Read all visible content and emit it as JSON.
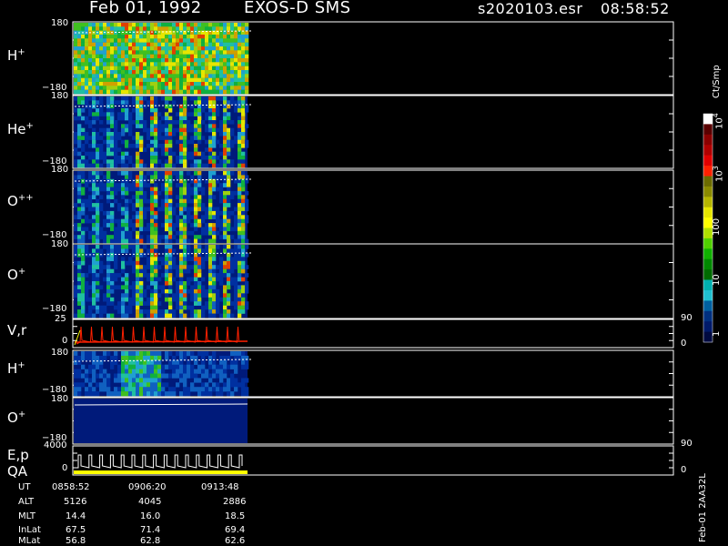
{
  "header": {
    "date": "Feb 01, 1992",
    "instrument": "EXOS-D SMS",
    "file": "s2020103.esr",
    "time": "08:58:52"
  },
  "panels": [
    {
      "label": "H",
      "charge": "+",
      "ymax": "180",
      "ymin": "−180"
    },
    {
      "label": "He",
      "charge": "+",
      "ymax": "180",
      "ymin": "−180"
    },
    {
      "label": "O",
      "charge": "++",
      "ymax": "180",
      "ymin": "−180"
    },
    {
      "label": "O",
      "charge": "+",
      "ymax": "180",
      "ymin": "−180"
    },
    {
      "label": "V,r",
      "ymax": "25",
      "ymin": "0",
      "right_max": "90",
      "right_min": "0"
    },
    {
      "label": "H",
      "charge": "+",
      "ymax": "180",
      "ymin": "−180"
    },
    {
      "label": "O",
      "charge": "+",
      "ymax": "180",
      "ymin": "−180"
    },
    {
      "label": "E,p",
      "label2": "QA",
      "ymax": "4000",
      "ymin": "0",
      "right_max": "90",
      "right_min": "0"
    }
  ],
  "colorbar": {
    "unit": "Ct/Smp",
    "labels": [
      "10",
      "4",
      "10",
      "3",
      "100",
      "10",
      "1"
    ],
    "colors": [
      "#ffffff",
      "#5a0000",
      "#8b0000",
      "#b00000",
      "#e00000",
      "#ff2000",
      "#6b6b00",
      "#8a8a00",
      "#b5b500",
      "#e6e600",
      "#ffff00",
      "#b0e000",
      "#50d000",
      "#10b000",
      "#008800",
      "#006a00",
      "#00b0b0",
      "#20c0d0",
      "#0060a0",
      "#003080",
      "#001a6a",
      "#000a40"
    ]
  },
  "footer": {
    "columns": [
      "0858:52",
      "0906:20",
      "0913:48"
    ],
    "rows": [
      {
        "label": "UT",
        "values": [
          "0858:52",
          "0906:20",
          "0913:48"
        ]
      },
      {
        "label": "ALT",
        "values": [
          "5126",
          "4045",
          "2886"
        ]
      },
      {
        "label": "MLT",
        "values": [
          "14.4",
          "16.0",
          "18.5"
        ]
      },
      {
        "label": "InLat",
        "values": [
          "67.5",
          "71.4",
          "69.4"
        ]
      },
      {
        "label": "MLat",
        "values": [
          "56.8",
          "62.8",
          "62.6"
        ]
      }
    ],
    "stamp": "Feb-01 2AA32L"
  },
  "chart_data": {
    "type": "heatmap",
    "title": "Feb 01, 1992   EXOS-D SMS",
    "xlabel": "UT",
    "x_ticks": [
      "0858:52",
      "0906:20",
      "0913:48"
    ],
    "panels": [
      {
        "name": "H+",
        "ylim": [
          -180,
          180
        ]
      },
      {
        "name": "He+",
        "ylim": [
          -180,
          180
        ]
      },
      {
        "name": "O++",
        "ylim": [
          -180,
          180
        ]
      },
      {
        "name": "O+",
        "ylim": [
          -180,
          180
        ]
      },
      {
        "name": "V,r",
        "ylim": [
          0,
          25
        ],
        "right_ylim": [
          0,
          90
        ]
      },
      {
        "name": "H+",
        "ylim": [
          -180,
          180
        ]
      },
      {
        "name": "O+",
        "ylim": [
          -180,
          180
        ]
      },
      {
        "name": "E,p / QA",
        "ylim": [
          0,
          4000
        ],
        "right_ylim": [
          0,
          90
        ]
      }
    ],
    "colorbar": {
      "label": "Ct/Smp",
      "scale": "log",
      "range": [
        1,
        10000
      ],
      "ticks": [
        "1",
        "10",
        "100",
        "10^3",
        "10^4"
      ]
    }
  }
}
